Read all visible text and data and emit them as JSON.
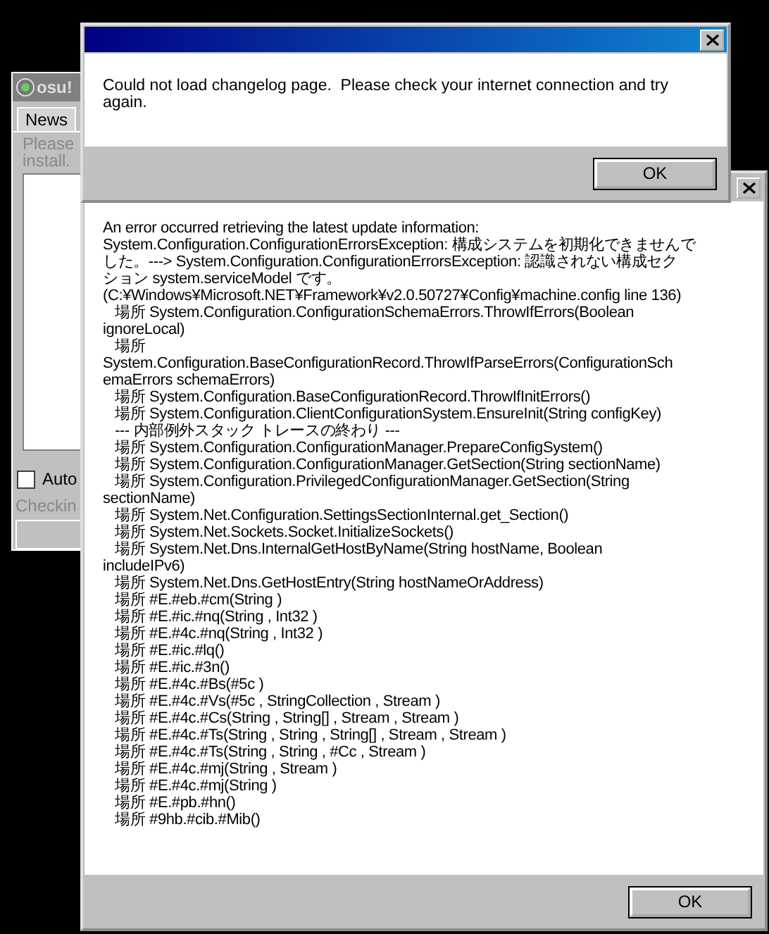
{
  "background_window": {
    "title": "osu!",
    "tabs": [
      {
        "label": "News",
        "selected": true
      }
    ],
    "notice_lines": [
      "Please",
      "install."
    ],
    "checkbox": {
      "label": "Auto",
      "checked": false
    },
    "status": "Checkin"
  },
  "dialogs": [
    {
      "active": true,
      "message": "Could not load changelog page.  Please check your internet connection and try again.",
      "buttons": [
        "OK"
      ]
    },
    {
      "active": false,
      "lines": [
        "An error occurred retrieving the latest update information:",
        "System.Configuration.ConfigurationErrorsException: 構成システムを初期化できませんで",
        "した。---> System.Configuration.ConfigurationErrorsException: 認識されない構成セク",
        "ション system.serviceModel です。",
        "(C:¥Windows¥Microsoft.NET¥Framework¥v2.0.50727¥Config¥machine.config line 136)",
        "   場所 System.Configuration.ConfigurationSchemaErrors.ThrowIfErrors(Boolean",
        "ignoreLocal)",
        "   場所",
        "System.Configuration.BaseConfigurationRecord.ThrowIfParseErrors(ConfigurationSch",
        "emaErrors schemaErrors)",
        "   場所 System.Configuration.BaseConfigurationRecord.ThrowIfInitErrors()",
        "   場所 System.Configuration.ClientConfigurationSystem.EnsureInit(String configKey)",
        "   --- 内部例外スタック トレースの終わり ---",
        "   場所 System.Configuration.ConfigurationManager.PrepareConfigSystem()",
        "   場所 System.Configuration.ConfigurationManager.GetSection(String sectionName)",
        "   場所 System.Configuration.PrivilegedConfigurationManager.GetSection(String",
        "sectionName)",
        "   場所 System.Net.Configuration.SettingsSectionInternal.get_Section()",
        "   場所 System.Net.Sockets.Socket.InitializeSockets()",
        "   場所 System.Net.Dns.InternalGetHostByName(String hostName, Boolean",
        "includeIPv6)",
        "   場所 System.Net.Dns.GetHostEntry(String hostNameOrAddress)",
        "   場所 #E.#eb.#cm(String )",
        "   場所 #E.#ic.#nq(String , Int32 )",
        "   場所 #E.#4c.#nq(String , Int32 )",
        "   場所 #E.#ic.#lq()",
        "   場所 #E.#ic.#3n()",
        "   場所 #E.#4c.#Bs(#5c )",
        "   場所 #E.#4c.#Vs(#5c , StringCollection , Stream )",
        "   場所 #E.#4c.#Cs(String , String[] , Stream , Stream )",
        "   場所 #E.#4c.#Ts(String , String , String[] , Stream , Stream )",
        "   場所 #E.#4c.#Ts(String , String , #Cc , Stream )",
        "   場所 #E.#4c.#mj(String , Stream )",
        "   場所 #E.#4c.#mj(String )",
        "   場所 #E.#pb.#hn()",
        "   場所 #9hb.#cib.#Mib()"
      ],
      "buttons": [
        "OK"
      ]
    }
  ]
}
